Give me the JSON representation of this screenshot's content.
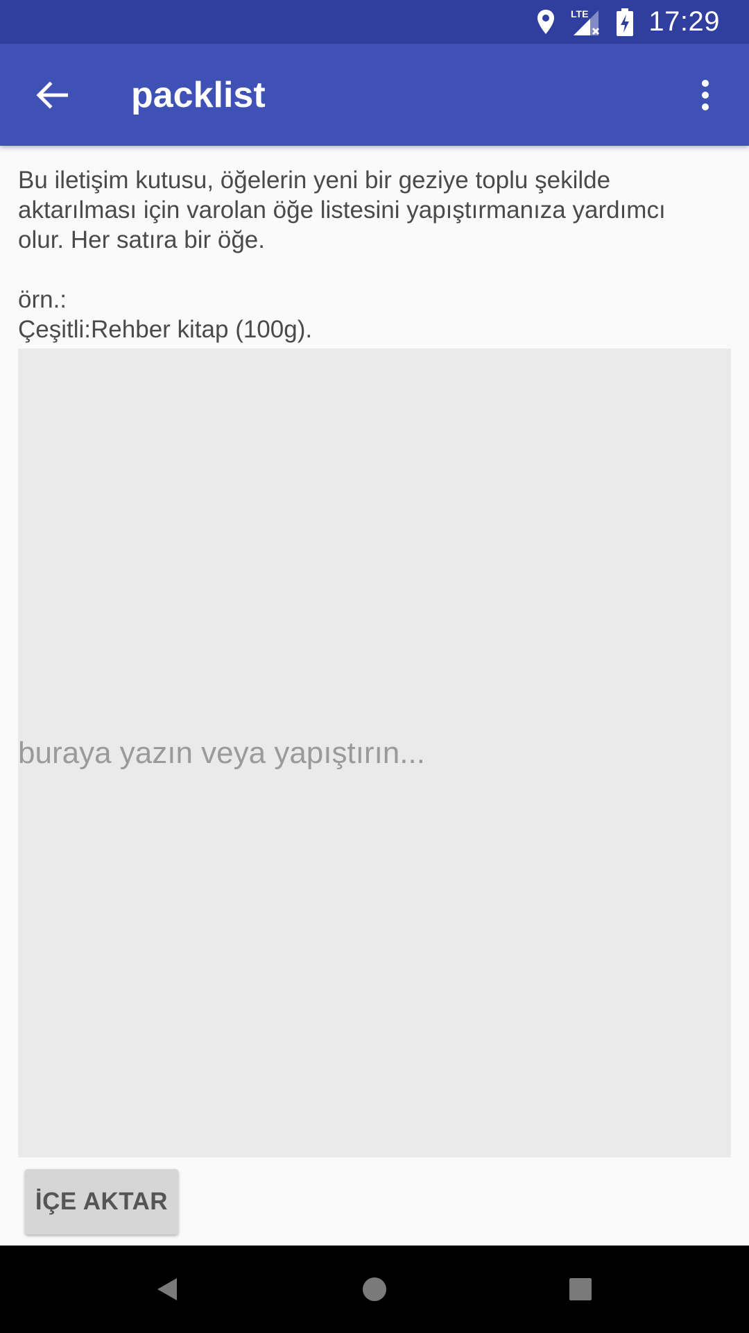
{
  "status_bar": {
    "time": "17:29",
    "network_label": "LTE",
    "icons": [
      "location-icon",
      "signal-icon",
      "battery-charging-icon"
    ]
  },
  "app_bar": {
    "title": "packlist",
    "back_icon": "arrow-back-icon",
    "menu_icon": "more-vert-icon"
  },
  "description": {
    "line1": "Bu iletişim kutusu, öğelerin yeni bir geziye toplu şekilde",
    "line2": "aktarılması için varolan öğe listesini yapıştırmanıza yardımcı",
    "line3": "olur. Her satıra bir öğe.",
    "example_label": "örn.:",
    "example_value": "Çeşitli:Rehber kitap (100g)."
  },
  "input": {
    "placeholder": "buraya yazın veya yapıştırın...",
    "value": ""
  },
  "import_button": {
    "label": "İÇE AKTAR"
  },
  "nav_bar": {
    "icons": [
      "back-triangle-icon",
      "home-circle-icon",
      "recents-square-icon"
    ]
  },
  "colors": {
    "status_bar": "#303f9f",
    "app_bar": "#3f51b5",
    "background": "#fafafa",
    "input_bg": "#eaeaea",
    "button_bg": "#d6d6d6"
  }
}
